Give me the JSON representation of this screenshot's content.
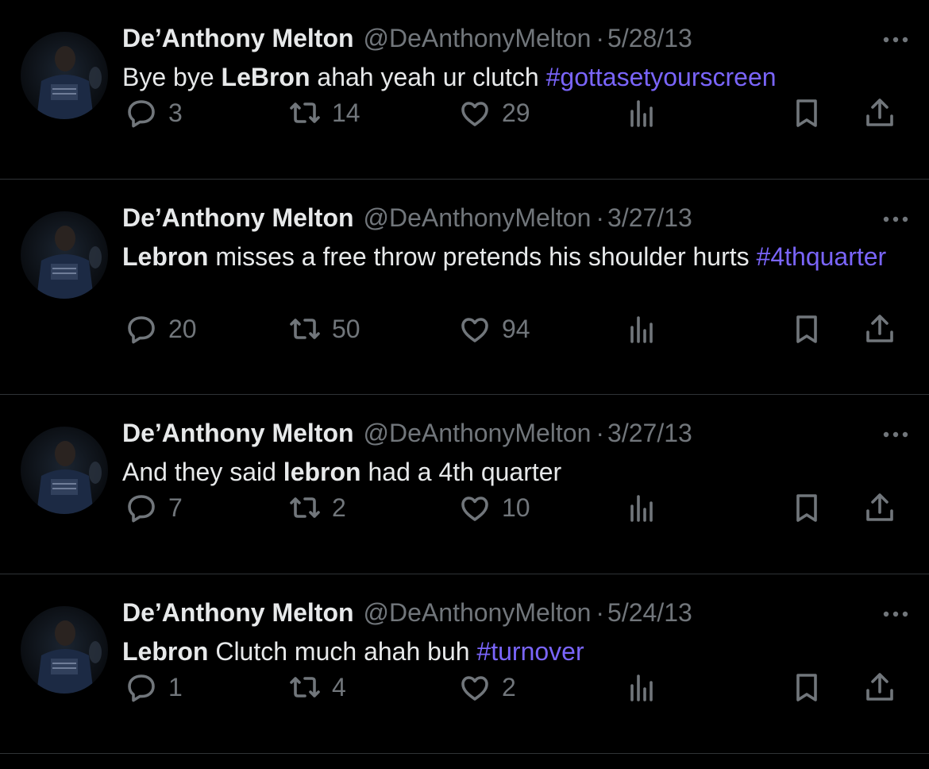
{
  "tweets": [
    {
      "name": "De’Anthony Melton",
      "handle": "@DeAnthonyMelton",
      "separator": "·",
      "date": "5/28/13",
      "text": [
        {
          "t": "Bye bye ",
          "style": "plain"
        },
        {
          "t": "LeBron",
          "style": "bold"
        },
        {
          "t": " ahah yeah ur clutch ",
          "style": "plain"
        },
        {
          "t": "#gottasetyourscreen",
          "style": "hashtag"
        }
      ],
      "replies": "3",
      "retweets": "14",
      "likes": "29"
    },
    {
      "name": "De’Anthony Melton",
      "handle": "@DeAnthonyMelton",
      "separator": "·",
      "date": "3/27/13",
      "text": [
        {
          "t": "Lebron",
          "style": "bold"
        },
        {
          "t": " misses a free throw pretends his shoulder hurts ",
          "style": "plain"
        },
        {
          "t": "#4thquarter",
          "style": "hashtag"
        }
      ],
      "replies": "20",
      "retweets": "50",
      "likes": "94"
    },
    {
      "name": "De’Anthony Melton",
      "handle": "@DeAnthonyMelton",
      "separator": "·",
      "date": "3/27/13",
      "text": [
        {
          "t": "And they said ",
          "style": "plain"
        },
        {
          "t": "lebron",
          "style": "bold"
        },
        {
          "t": " had a 4th quarter",
          "style": "plain"
        }
      ],
      "replies": "7",
      "retweets": "2",
      "likes": "10"
    },
    {
      "name": "De’Anthony Melton",
      "handle": "@DeAnthonyMelton",
      "separator": "·",
      "date": "5/24/13",
      "text": [
        {
          "t": "Lebron",
          "style": "bold"
        },
        {
          "t": " Clutch much ahah buh ",
          "style": "plain"
        },
        {
          "t": "#turnover",
          "style": "hashtag"
        }
      ],
      "replies": "1",
      "retweets": "4",
      "likes": "2"
    }
  ],
  "icons": {
    "reply": "reply-icon",
    "retweet": "retweet-icon",
    "like": "heart-icon",
    "views": "views-icon",
    "bookmark": "bookmark-icon",
    "share": "share-icon",
    "more": "more-icon"
  },
  "colors": {
    "background": "#000000",
    "text": "#e7e9ea",
    "muted": "#71767b",
    "hashtag": "#7a65fb",
    "divider": "#2f3336"
  }
}
